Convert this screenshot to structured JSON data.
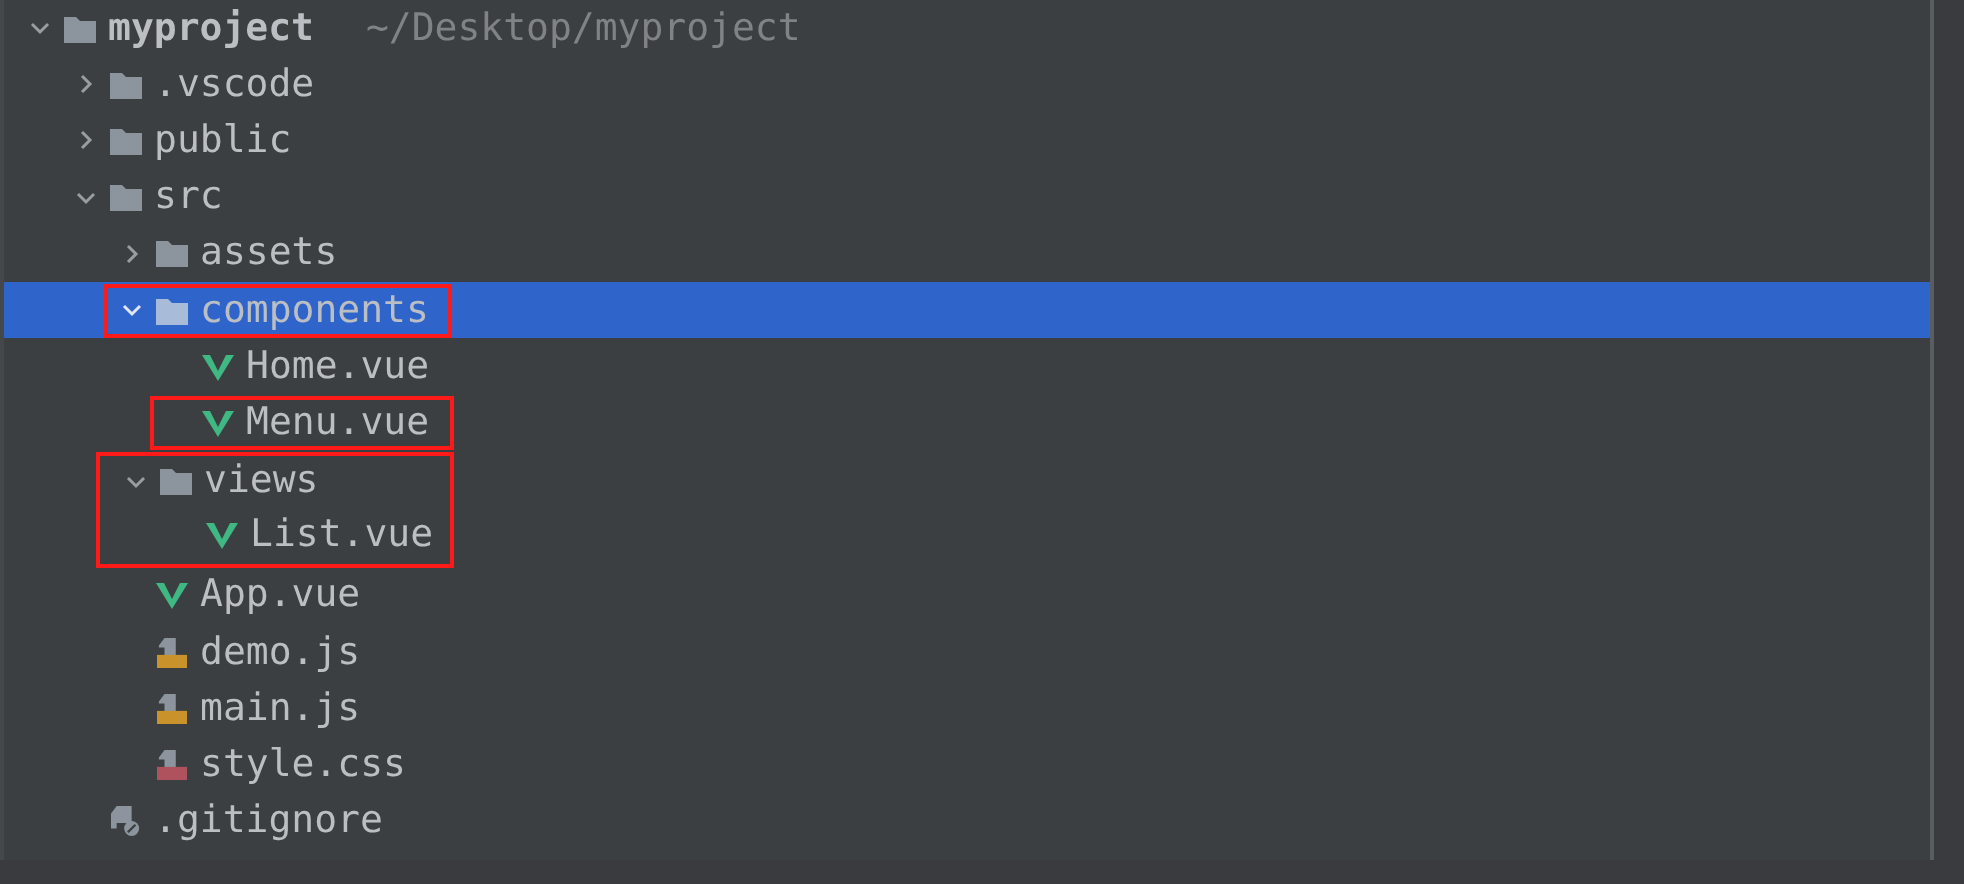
{
  "tree": [
    {
      "kind": "folder",
      "name": "myproject",
      "path": "~/Desktop/myproject",
      "expanded": true,
      "selected": false,
      "highlighted": false,
      "children": [
        {
          "kind": "folder",
          "name": ".vscode",
          "expanded": false,
          "selected": false,
          "highlighted": false
        },
        {
          "kind": "folder",
          "name": "public",
          "expanded": false,
          "selected": false,
          "highlighted": false
        },
        {
          "kind": "folder",
          "name": "src",
          "expanded": true,
          "selected": false,
          "highlighted": false,
          "children": [
            {
              "kind": "folder",
              "name": "assets",
              "expanded": false,
              "selected": false,
              "highlighted": false
            },
            {
              "kind": "folder",
              "name": "components",
              "expanded": true,
              "selected": true,
              "highlighted": true,
              "children": [
                {
                  "kind": "vue",
                  "name": "Home.vue",
                  "selected": false,
                  "highlighted": false
                },
                {
                  "kind": "vue",
                  "name": "Menu.vue",
                  "selected": false,
                  "highlighted": true
                }
              ]
            },
            {
              "kind": "folder",
              "name": "views",
              "expanded": true,
              "selected": false,
              "highlighted": false,
              "group_highlighted": true,
              "children": [
                {
                  "kind": "vue",
                  "name": "List.vue",
                  "selected": false,
                  "highlighted": false
                }
              ]
            },
            {
              "kind": "vue",
              "name": "App.vue",
              "selected": false,
              "highlighted": false
            },
            {
              "kind": "js",
              "name": "demo.js",
              "selected": false,
              "highlighted": false
            },
            {
              "kind": "js",
              "name": "main.js",
              "selected": false,
              "highlighted": false
            },
            {
              "kind": "css",
              "name": "style.css",
              "selected": false,
              "highlighted": false
            }
          ]
        },
        {
          "kind": "ignore",
          "name": ".gitignore",
          "selected": false,
          "highlighted": false
        }
      ]
    }
  ]
}
